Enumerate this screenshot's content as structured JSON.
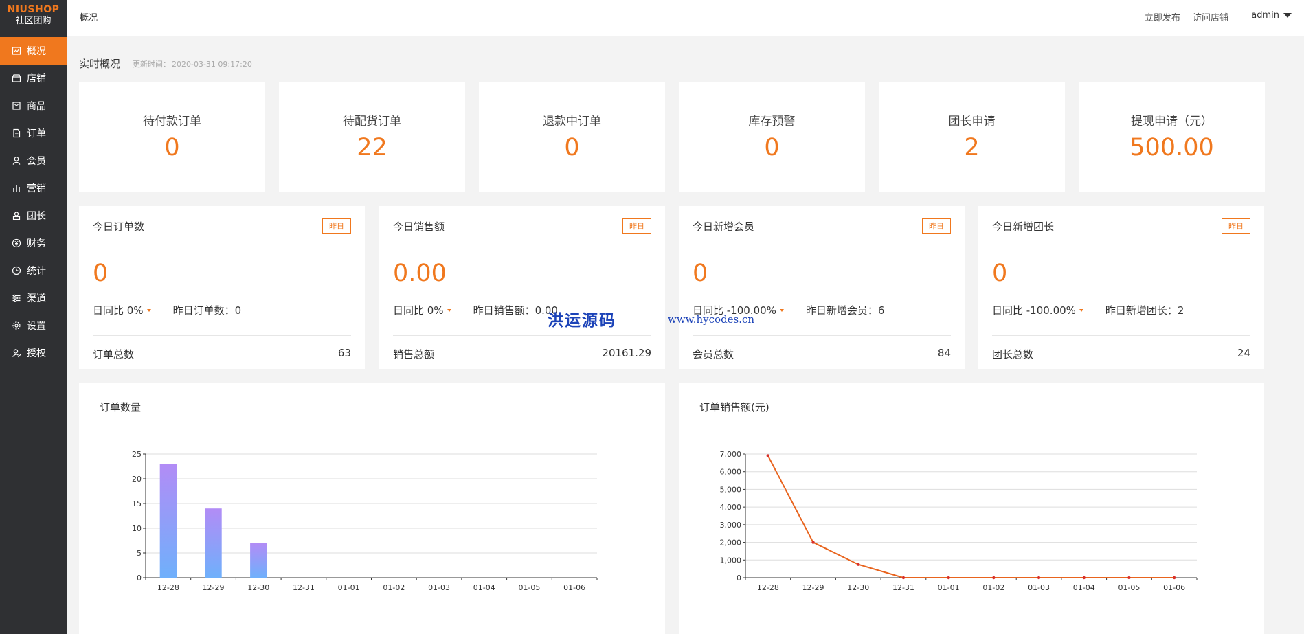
{
  "sidebar": {
    "brand": "NIUSHOP",
    "subtitle": "社区团购",
    "items": [
      {
        "label": "概况",
        "icon": "chart-icon",
        "active": true
      },
      {
        "label": "店铺",
        "icon": "store-icon"
      },
      {
        "label": "商品",
        "icon": "product-icon"
      },
      {
        "label": "订单",
        "icon": "order-icon"
      },
      {
        "label": "会员",
        "icon": "member-icon"
      },
      {
        "label": "营销",
        "icon": "marketing-icon"
      },
      {
        "label": "团长",
        "icon": "leader-icon"
      },
      {
        "label": "财务",
        "icon": "yuan-icon"
      },
      {
        "label": "统计",
        "icon": "clock-icon"
      },
      {
        "label": "渠道",
        "icon": "channel-icon"
      },
      {
        "label": "设置",
        "icon": "gear-icon"
      },
      {
        "label": "授权",
        "icon": "authorize-icon"
      }
    ]
  },
  "topbar": {
    "breadcrumb": "概况",
    "publish": "立即发布",
    "visit": "访问店铺",
    "user": "admin"
  },
  "overview": {
    "title": "实时概况",
    "update_label": "更新时间：",
    "update_time": "2020-03-31 09:17:20"
  },
  "stats": [
    {
      "label": "待付款订单",
      "value": "0"
    },
    {
      "label": "待配货订单",
      "value": "22"
    },
    {
      "label": "退款中订单",
      "value": "0"
    },
    {
      "label": "库存预警",
      "value": "0"
    },
    {
      "label": "团长申请",
      "value": "2"
    },
    {
      "label": "提现申请（元）",
      "value": "500.00"
    }
  ],
  "today": [
    {
      "title": "今日订单数",
      "badge": "昨日",
      "value": "0",
      "cmp": "日同比 0%",
      "yesterday": "昨日订单数：0",
      "total_label": "订单总数",
      "total": "63"
    },
    {
      "title": "今日销售额",
      "badge": "昨日",
      "value": "0.00",
      "cmp": "日同比 0%",
      "yesterday": "昨日销售额：0.00",
      "total_label": "销售总额",
      "total": "20161.29"
    },
    {
      "title": "今日新增会员",
      "badge": "昨日",
      "value": "0",
      "cmp": "日同比 -100.00%",
      "yesterday": "昨日新增会员：6",
      "total_label": "会员总数",
      "total": "84"
    },
    {
      "title": "今日新增团长",
      "badge": "昨日",
      "value": "0",
      "cmp": "日同比 -100.00%",
      "yesterday": "昨日新增团长：2",
      "total_label": "团长总数",
      "total": "24"
    }
  ],
  "watermark": {
    "text": "洪运源码",
    "url": "www.hycodes.cn"
  },
  "colors": {
    "accent": "#f0781e",
    "sidebar": "#2f3033",
    "bar_top": "#b28cf6",
    "bar_bottom": "#6fb0fb",
    "line": "#e8641e"
  },
  "chart_data": [
    {
      "type": "bar",
      "title": "订单数量",
      "categories": [
        "12-28",
        "12-29",
        "12-30",
        "12-31",
        "01-01",
        "01-02",
        "01-03",
        "01-04",
        "01-05",
        "01-06"
      ],
      "values": [
        23,
        14,
        7,
        0,
        0,
        0,
        0,
        0,
        0,
        0
      ],
      "yticks": [
        "0",
        "5",
        "10",
        "15",
        "20",
        "25"
      ],
      "ylim": [
        0,
        25
      ],
      "grid": true
    },
    {
      "type": "line",
      "title": "订单销售额(元)",
      "categories": [
        "12-28",
        "12-29",
        "12-30",
        "12-31",
        "01-01",
        "01-02",
        "01-03",
        "01-04",
        "01-05",
        "01-06"
      ],
      "values": [
        6900,
        2000,
        750,
        0,
        0,
        0,
        0,
        0,
        0,
        0
      ],
      "yticks": [
        "0",
        "1,000",
        "2,000",
        "3,000",
        "4,000",
        "5,000",
        "6,000",
        "7,000"
      ],
      "ylim": [
        0,
        7000
      ],
      "grid": true
    }
  ]
}
